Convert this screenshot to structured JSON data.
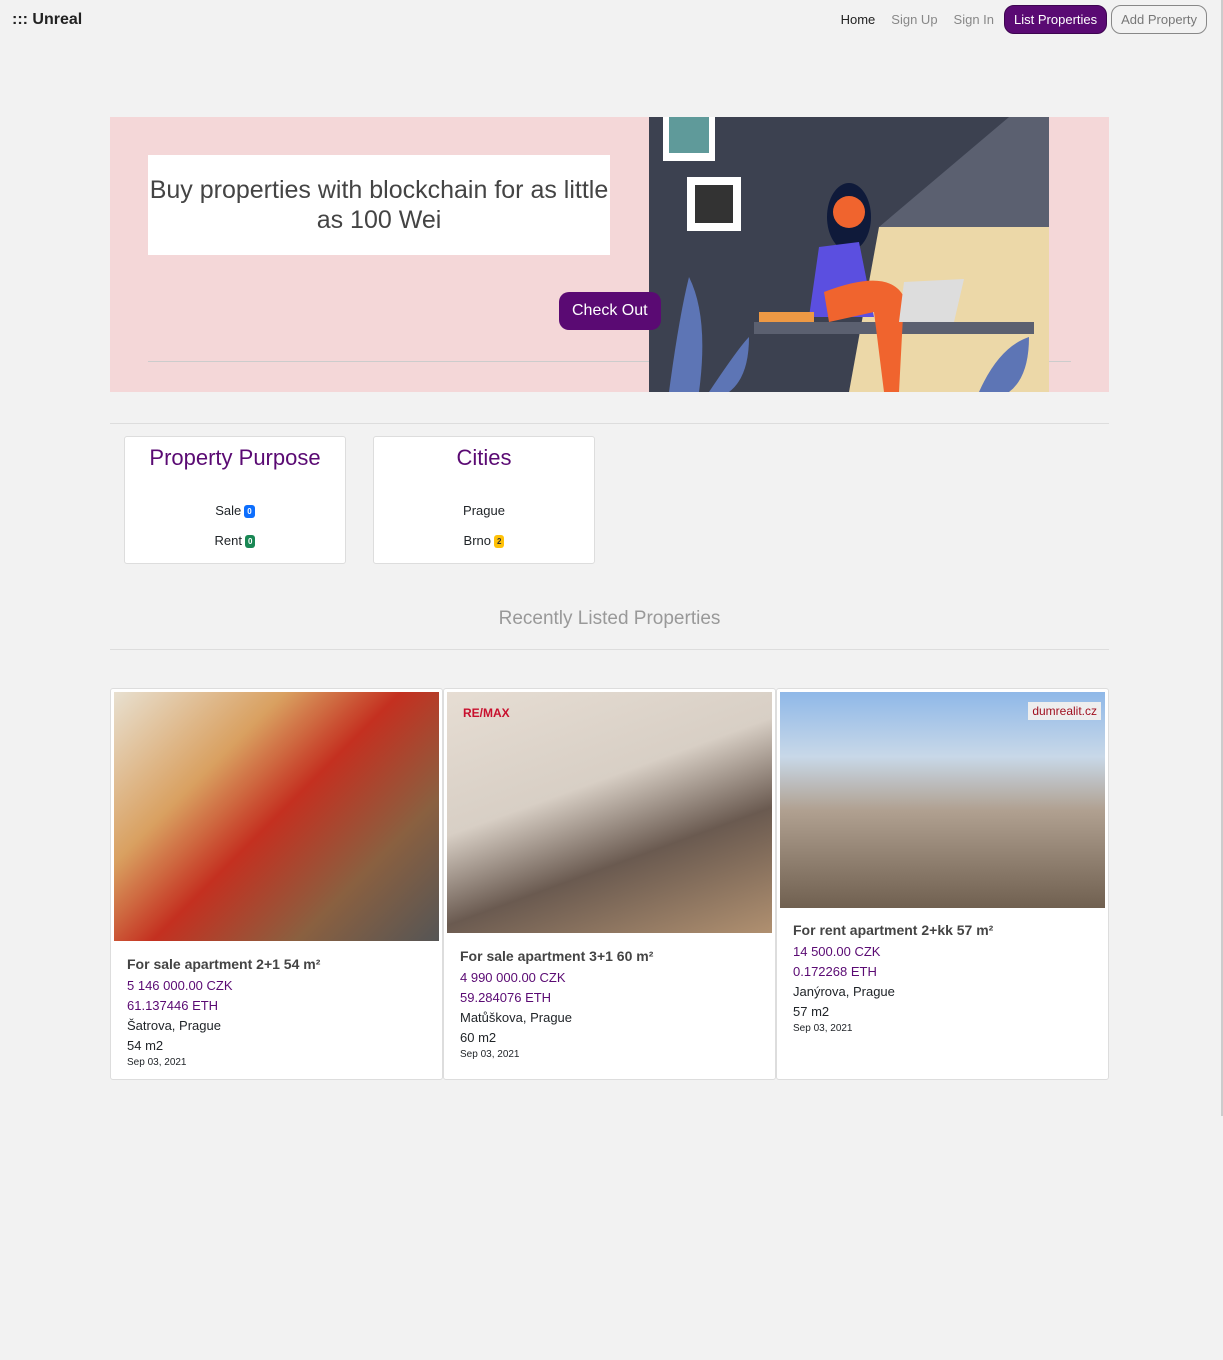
{
  "nav": {
    "brand": "::: Unreal",
    "home": "Home",
    "signup": "Sign Up",
    "signin": "Sign In",
    "list": "List Properties",
    "add": "Add Property"
  },
  "hero": {
    "headline": "Buy properties with blockchain for as little as 100 Wei",
    "cta": "Check Out"
  },
  "filters": {
    "purpose": {
      "title": "Property Purpose",
      "items": [
        {
          "label": "Sale",
          "count": "0",
          "color": "#0d6efd"
        },
        {
          "label": "Rent",
          "count": "0",
          "color": "#198754"
        }
      ]
    },
    "cities": {
      "title": "Cities",
      "items": [
        {
          "label": "Prague",
          "count": ""
        },
        {
          "label": "Brno",
          "count": "2",
          "color": "#ffc107"
        }
      ]
    }
  },
  "recent_title": "Recently Listed Properties",
  "properties": [
    {
      "title": "For sale apartment 2+1 54 m²",
      "czk": "5 146 000.00 CZK",
      "eth": "61.137446 ETH",
      "address": "Šatrova, Prague",
      "area": "54 m2",
      "date": "Sep 03, 2021"
    },
    {
      "title": "For sale apartment 3+1 60 m²",
      "czk": "4 990 000.00 CZK",
      "eth": "59.284076 ETH",
      "address": "Matůškova, Prague",
      "area": "60 m2",
      "date": "Sep 03, 2021",
      "watermark": "RE/MAX"
    },
    {
      "title": "For rent apartment 2+kk 57 m²",
      "czk": "14 500.00 CZK",
      "eth": "0.172268 ETH",
      "address": "Janýrova, Prague",
      "area": "57 m2",
      "date": "Sep 03, 2021",
      "watermark": "dumrealit.cz"
    }
  ]
}
